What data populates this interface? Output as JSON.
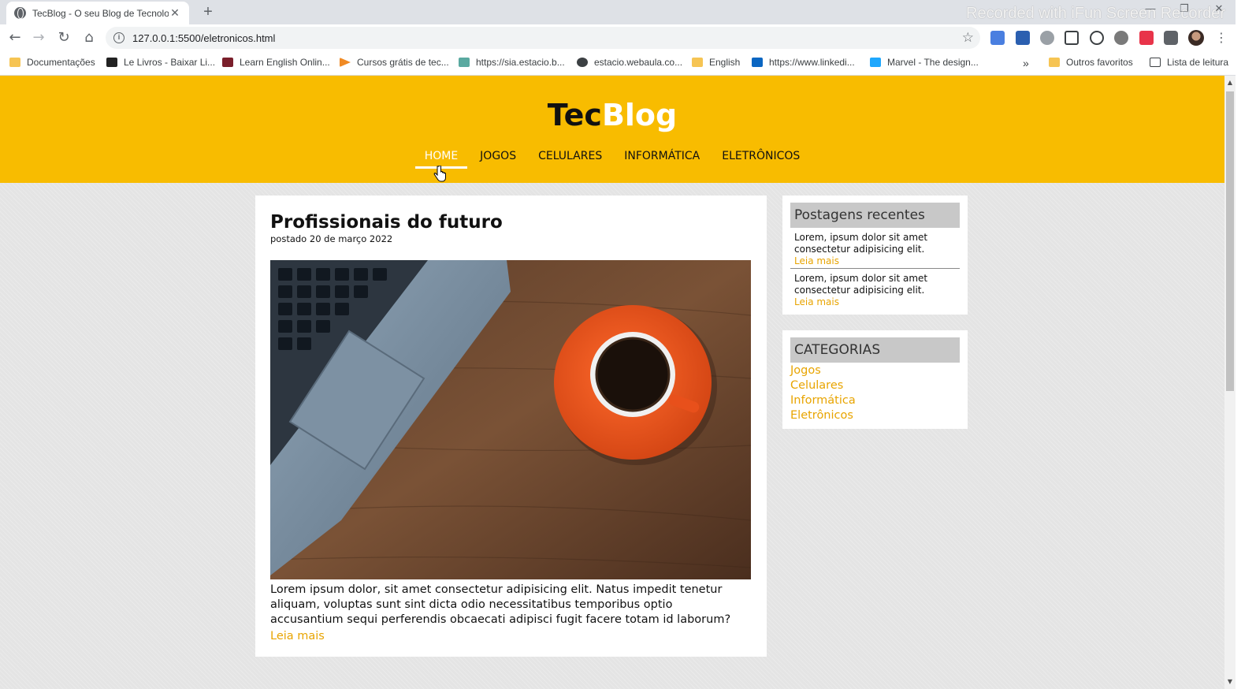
{
  "browser": {
    "tab_title": "TecBlog - O seu Blog de Tecnolo",
    "tab_close": "✕",
    "new_tab": "+",
    "recorder_watermark": "Recorded with iFun Screen Recorder",
    "url": "127.0.0.1:5500/eletronicos.html",
    "back": "←",
    "forward": "→",
    "reload": "↻",
    "home": "⌂",
    "star": "☆",
    "menu": "⋮",
    "window_minimize": "—",
    "window_restore": "❐",
    "window_close": "✕"
  },
  "bookmarks": [
    {
      "label": "Documentações",
      "icon": "folder-icon"
    },
    {
      "label": "Le Livros - Baixar Li...",
      "icon": "book-icon"
    },
    {
      "label": "Learn English Onlin...",
      "icon": "star-logo-icon"
    },
    {
      "label": "Cursos grátis de tec...",
      "icon": "play-icon"
    },
    {
      "label": "https://sia.estacio.b...",
      "icon": "cube-icon"
    },
    {
      "label": "estacio.webaula.co...",
      "icon": "globe-icon"
    },
    {
      "label": "English",
      "icon": "folder-icon"
    },
    {
      "label": "https://www.linkedi...",
      "icon": "linkedin-icon"
    },
    {
      "label": "Marvel - The design...",
      "icon": "marvel-icon"
    }
  ],
  "bookmarks_more": "»",
  "bookmarks_right": [
    {
      "label": "Outros favoritos",
      "icon": "folder-icon"
    },
    {
      "label": "Lista de leitura",
      "icon": "reading-list-icon"
    }
  ],
  "site": {
    "logo_tec": "Tec",
    "logo_blog": "Blog",
    "nav": [
      "HOME",
      "JOGOS",
      "CELULARES",
      "INFORMÁTICA",
      "ELETRÔNICOS"
    ],
    "active_nav": "HOME"
  },
  "post": {
    "title": "Profissionais do futuro",
    "date": "postado 20 de março 2022",
    "image": "laptop-and-coffee-cup-on-wooden-desk",
    "text": "Lorem ipsum dolor, sit amet consectetur adipisicing elit. Natus impedit tenetur aliquam, voluptas sunt sint dicta odio necessitatibus temporibus optio accusantium sequi perferendis obcaecati adipisci fugit facere totam id laborum?",
    "read_more": "Leia mais"
  },
  "sidebar": {
    "recent_title": "Postagens recentes",
    "recent_posts": [
      {
        "text": "Lorem, ipsum dolor sit amet consectetur adipisicing elit.",
        "link": "Leia mais"
      },
      {
        "text": "Lorem, ipsum dolor sit amet consectetur adipisicing elit.",
        "link": "Leia mais"
      }
    ],
    "categories_title": "CATEGORIAS",
    "categories": [
      "Jogos",
      "Celulares",
      "Informática",
      "Eletrônicos"
    ]
  },
  "colors": {
    "header": "#f8bc00",
    "link": "#e8a400",
    "widget_title_bg": "#c8c8c8"
  }
}
